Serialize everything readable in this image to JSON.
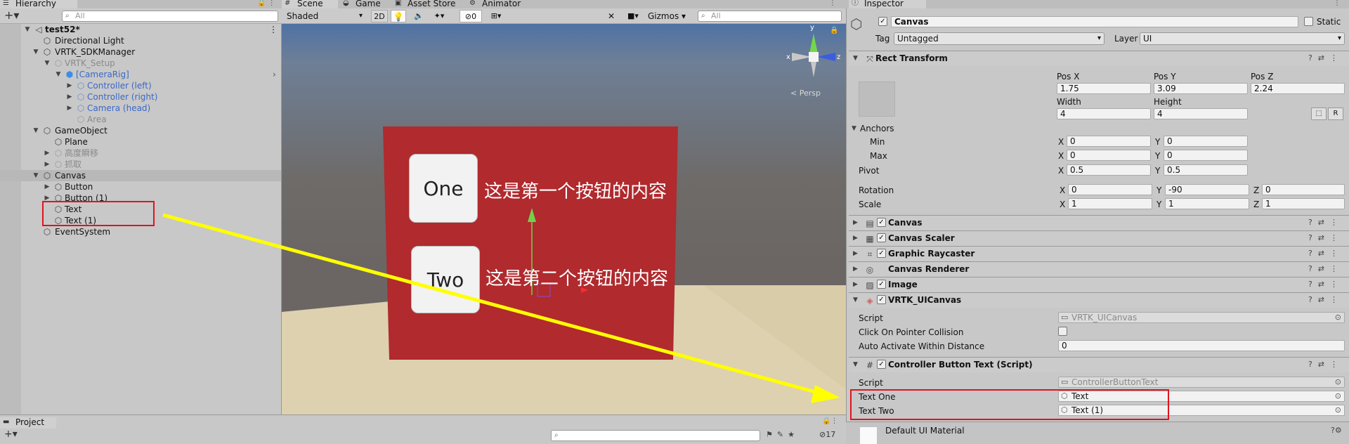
{
  "hierarchy": {
    "tab_label": "Hierarchy",
    "search_placeholder": "All",
    "scene_name": "test52*",
    "items": [
      {
        "label": "Directional Light"
      },
      {
        "label": "VRTK_SDKManager"
      },
      {
        "label": "VRTK_Setup"
      },
      {
        "label": "[CameraRig]"
      },
      {
        "label": "Controller (left)"
      },
      {
        "label": "Controller (right)"
      },
      {
        "label": "Camera (head)"
      },
      {
        "label": "Area"
      },
      {
        "label": "GameObject"
      },
      {
        "label": "Plane"
      },
      {
        "label": "高度瞬移"
      },
      {
        "label": "抓取"
      },
      {
        "label": "Canvas"
      },
      {
        "label": "Button"
      },
      {
        "label": "Button (1)"
      },
      {
        "label": "Text"
      },
      {
        "label": "Text (1)"
      },
      {
        "label": "EventSystem"
      }
    ]
  },
  "scene": {
    "tabs": [
      {
        "label": "Scene"
      },
      {
        "label": "Game"
      },
      {
        "label": "Asset Store"
      },
      {
        "label": "Animator"
      }
    ],
    "shading_mode": "Shaded",
    "mode_2d": "2D",
    "hidden_count": "0",
    "gizmos_label": "Gizmos",
    "search_placeholder": "All",
    "persp_label": "< Persp",
    "axis_y": "y",
    "axis_x": "x",
    "axis_z": "z",
    "button_one": "One",
    "button_two": "Two",
    "text_one": "这是第一个按钮的内容",
    "text_two": "这是第二个按钮的内容",
    "colors": {
      "sky": "#6d6a68",
      "ground": "#ddd1b0",
      "canvas": "#b02a2e",
      "arrow": "#ffff00",
      "highlight": "#e0141e"
    }
  },
  "project": {
    "tab_label": "Project",
    "hidden_count": "17"
  },
  "inspector": {
    "tab_label": "Inspector",
    "object_name": "Canvas",
    "static_label": "Static",
    "tag_label": "Tag",
    "tag_value": "Untagged",
    "layer_label": "Layer",
    "layer_value": "UI",
    "rect_transform": {
      "title": "Rect Transform",
      "pos_x_label": "Pos X",
      "pos_x": "1.75",
      "pos_y_label": "Pos Y",
      "pos_y": "3.09",
      "pos_z_label": "Pos Z",
      "pos_z": "2.24",
      "width_label": "Width",
      "width": "4",
      "height_label": "Height",
      "height": "4",
      "r_label": "R",
      "anchors_label": "Anchors",
      "min_label": "Min",
      "min_x": "0",
      "min_y": "0",
      "max_label": "Max",
      "max_x": "0",
      "max_y": "0",
      "pivot_label": "Pivot",
      "pivot_x": "0.5",
      "pivot_y": "0.5",
      "rotation_label": "Rotation",
      "rot_x": "0",
      "rot_y": "-90",
      "rot_z": "0",
      "scale_label": "Scale",
      "scale_x": "1",
      "scale_y": "1",
      "scale_z": "1",
      "x": "X",
      "y": "Y",
      "z": "Z"
    },
    "components": [
      {
        "name": "Canvas"
      },
      {
        "name": "Canvas Scaler"
      },
      {
        "name": "Graphic Raycaster"
      },
      {
        "name": "Canvas Renderer"
      },
      {
        "name": "Image"
      },
      {
        "name": "VRTK_UICanvas"
      }
    ],
    "vrtk_canvas": {
      "script_label": "Script",
      "script_value": "VRTK_UICanvas",
      "click_label": "Click On Pointer Collision",
      "auto_label": "Auto Activate Within Distance",
      "auto_value": "0"
    },
    "controller_text": {
      "title": "Controller Button Text (Script)",
      "script_label": "Script",
      "script_value": "ControllerButtonText",
      "text_one_label": "Text One",
      "text_one_value": "Text",
      "text_two_label": "Text Two",
      "text_two_value": "Text (1)"
    },
    "material_label": "Default UI Material"
  }
}
